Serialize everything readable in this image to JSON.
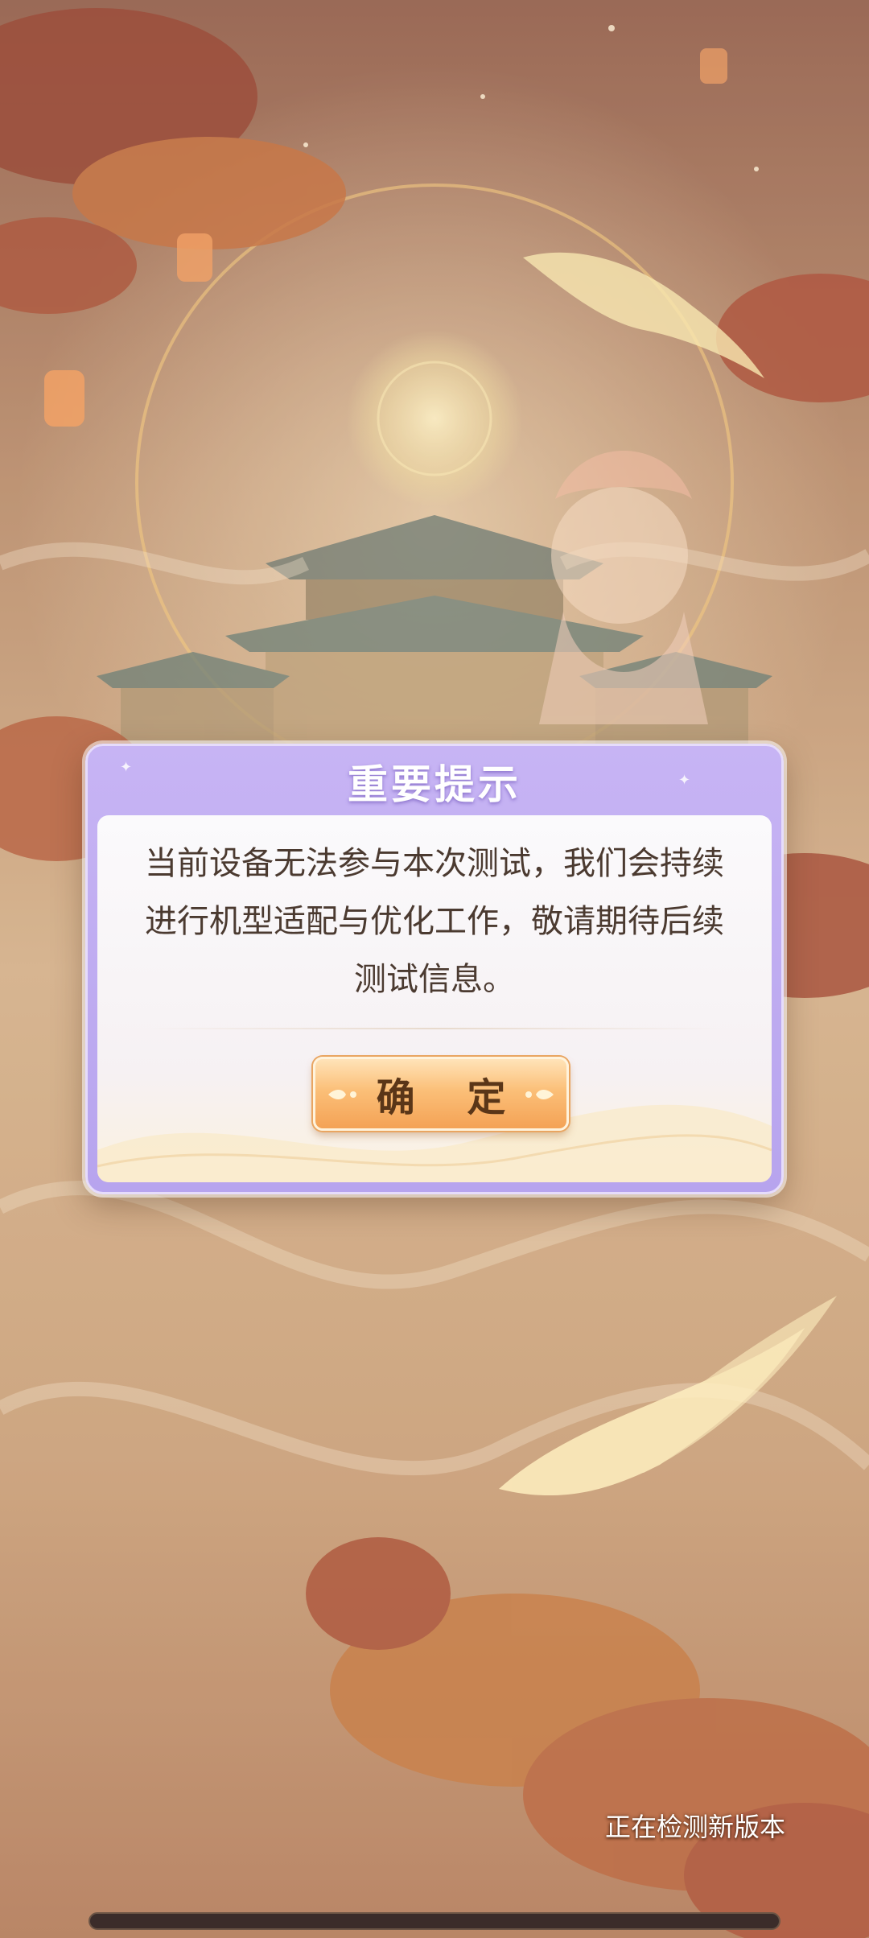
{
  "dialog": {
    "title": "重要提示",
    "message": "当前设备无法参与本次测试，我们会持续进行机型适配与优化工作，敬请期待后续测试信息。",
    "confirm_label": "确 定"
  },
  "status": {
    "text": "正在检测新版本"
  },
  "progress": {
    "fraction": 0
  },
  "colors": {
    "dialog_header": "#b9a6ef",
    "button_orange": "#f4a255",
    "text_brown": "#4b3a30"
  }
}
